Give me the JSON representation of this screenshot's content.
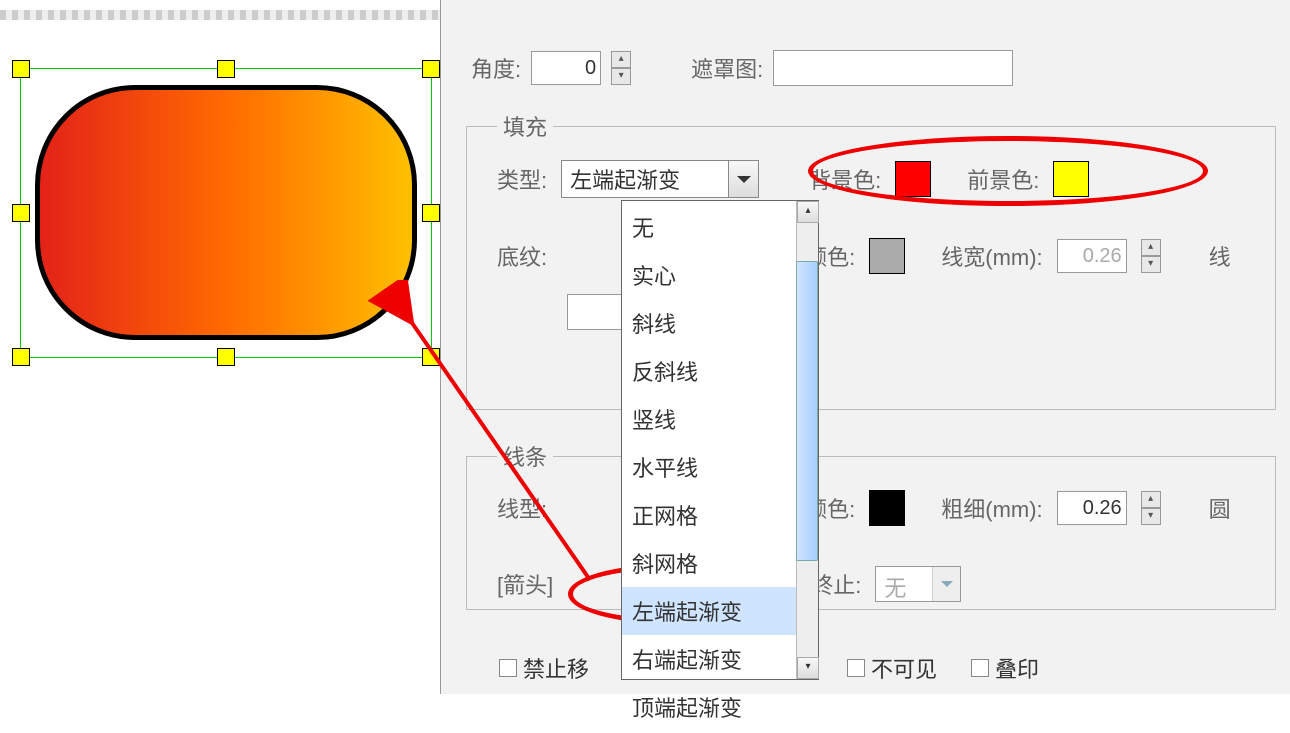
{
  "top": {
    "angle_label": "角度:",
    "angle_value": "0",
    "mask_label": "遮罩图:"
  },
  "fill": {
    "legend": "填充",
    "type_label": "类型:",
    "type_value": "左端起渐变",
    "pattern_label": "底纹:",
    "bg_label": "背景色:",
    "fg_label": "前景色:",
    "color_label": "颜色:",
    "linewidth_label": "线宽(mm):",
    "linewidth_value": "0.26",
    "line_suffix": "线",
    "options": [
      "无",
      "实心",
      "斜线",
      "反斜线",
      "竖线",
      "水平线",
      "正网格",
      "斜网格",
      "左端起渐变",
      "右端起渐变",
      "顶端起渐变"
    ],
    "selected_index": 8
  },
  "line": {
    "legend": "线条",
    "type_label": "线型:",
    "arrow_label": "[箭头]",
    "color_label": "颜色:",
    "width_label": "粗细(mm):",
    "width_value": "0.26",
    "round_label": "圆",
    "end_label": "终止:",
    "end_value": "无"
  },
  "checks": {
    "lock": "禁止移",
    "invisible": "不可见",
    "overprint": "叠印"
  },
  "colors": {
    "bg": "#ff0000",
    "fg": "#ffff00",
    "fill_line": "#aaaaaa",
    "line": "#000000"
  }
}
